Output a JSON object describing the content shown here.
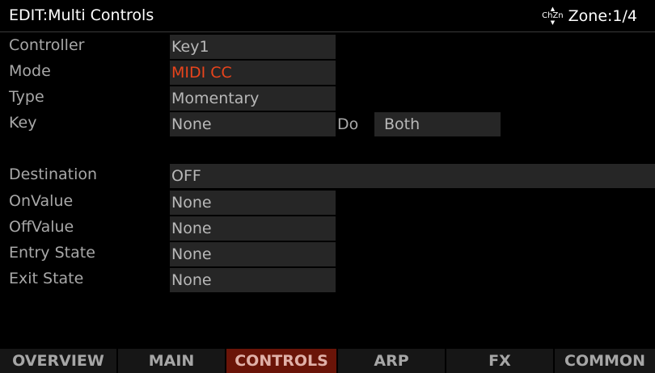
{
  "header": {
    "title": "EDIT:Multi Controls",
    "chzn_icon": "chzn-icon",
    "chzn_text": "ChZn",
    "zone": "Zone:1/4"
  },
  "params": {
    "controller": {
      "label": "Controller",
      "value": "Key1"
    },
    "mode": {
      "label": "Mode",
      "value": "MIDI CC"
    },
    "type": {
      "label": "Type",
      "value": "Momentary"
    },
    "key": {
      "label": "Key",
      "value": "None",
      "do_label": "Do",
      "do_value": "Both"
    },
    "destination": {
      "label": "Destination",
      "value": "OFF"
    },
    "on_value": {
      "label": "OnValue",
      "value": "None"
    },
    "off_value": {
      "label": "OffValue",
      "value": "None"
    },
    "entry_state": {
      "label": "Entry State",
      "value": "None"
    },
    "exit_state": {
      "label": "Exit State",
      "value": "None"
    }
  },
  "tabs": [
    {
      "label": "OVERVIEW",
      "active": false
    },
    {
      "label": "MAIN",
      "active": false
    },
    {
      "label": "CONTROLS",
      "active": true
    },
    {
      "label": "ARP",
      "active": false
    },
    {
      "label": "FX",
      "active": false
    },
    {
      "label": "COMMON",
      "active": false
    }
  ],
  "colors": {
    "accent": "#e8441c",
    "active_tab_bg": "#6a1408",
    "field_bg": "#262626"
  }
}
